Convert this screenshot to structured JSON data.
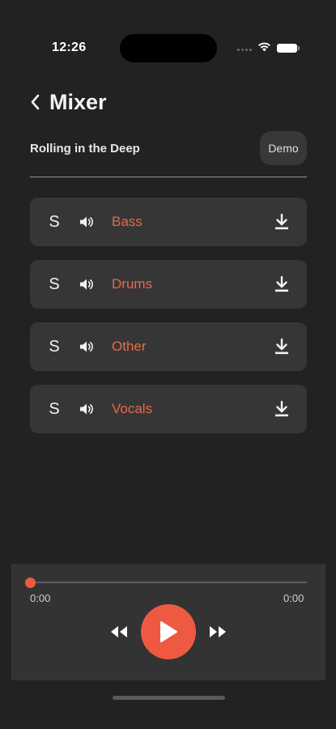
{
  "status_bar": {
    "time": "12:26",
    "icons": [
      "cellular-dots-icon",
      "wifi-icon",
      "battery-icon"
    ]
  },
  "header": {
    "back_icon": "chevron-left-icon",
    "title": "Mixer"
  },
  "song": {
    "name": "Rolling in the Deep",
    "demo_label": "Demo"
  },
  "tracks": [
    {
      "solo": "S",
      "name": "Bass",
      "mute_icon": "speaker-icon",
      "download_icon": "download-icon"
    },
    {
      "solo": "S",
      "name": "Drums",
      "mute_icon": "speaker-icon",
      "download_icon": "download-icon"
    },
    {
      "solo": "S",
      "name": "Other",
      "mute_icon": "speaker-icon",
      "download_icon": "download-icon"
    },
    {
      "solo": "S",
      "name": "Vocals",
      "mute_icon": "speaker-icon",
      "download_icon": "download-icon"
    }
  ],
  "player": {
    "elapsed": "0:00",
    "duration": "0:00",
    "progress": 0,
    "controls": [
      "rewind-icon",
      "play-icon",
      "fast-forward-icon"
    ]
  },
  "colors": {
    "background": "#222222",
    "accent": "#ee5a41",
    "track_name": "#e66a4c",
    "card": "#363636"
  }
}
